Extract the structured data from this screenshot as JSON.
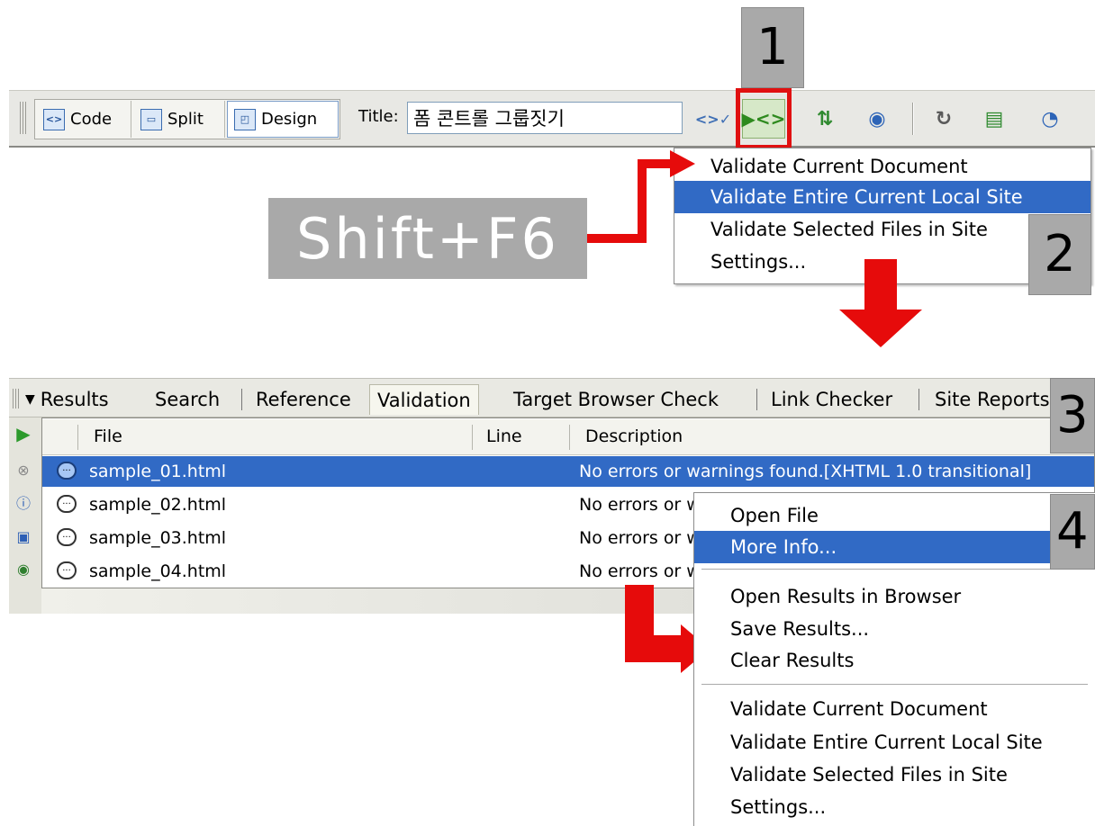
{
  "toolbar": {
    "views": [
      {
        "label": "Code",
        "icon": "code-view-icon"
      },
      {
        "label": "Split",
        "icon": "split-view-icon"
      },
      {
        "label": "Design",
        "icon": "design-view-icon"
      }
    ],
    "title_label": "Title:",
    "title_value": "폼 콘트롤 그룹짓기",
    "icons": [
      "browser-compat-icon",
      "validate-icon",
      "file-transfer-icon",
      "preview-browser-icon",
      "refresh-icon",
      "view-options-icon",
      "visual-aids-icon"
    ]
  },
  "callouts": {
    "one": "1",
    "two": "2",
    "three": "3",
    "four": "4"
  },
  "shortcut": "Shift+F6",
  "validate_menu": {
    "items": [
      {
        "label": "Validate Current Document",
        "selected": false
      },
      {
        "label": "Validate Entire Current Local Site",
        "selected": true
      },
      {
        "label": "Validate Selected Files in Site",
        "selected": false
      },
      {
        "label": "Settings...",
        "selected": false
      }
    ]
  },
  "results_panel": {
    "panel_title": "Results",
    "tabs": [
      "Search",
      "Reference",
      "Validation",
      "Target Browser Check",
      "Link Checker",
      "Site Reports"
    ],
    "active_tab": "Validation",
    "columns": [
      "File",
      "Line",
      "Description"
    ],
    "rows": [
      {
        "file": "sample_01.html",
        "line": "",
        "description": "No errors or warnings found.[XHTML 1.0 transitional]",
        "selected": true
      },
      {
        "file": "sample_02.html",
        "line": "",
        "description": "No errors or w",
        "selected": false
      },
      {
        "file": "sample_03.html",
        "line": "",
        "description": "No errors or w",
        "selected": false
      },
      {
        "file": "sample_04.html",
        "line": "",
        "description": "No errors or w",
        "selected": false
      }
    ],
    "side_icons": [
      "validate-run-icon",
      "stop-icon",
      "info-icon",
      "save-icon",
      "browse-icon"
    ]
  },
  "context_menu": {
    "group1": [
      {
        "label": "Open File",
        "selected": false
      },
      {
        "label": "More Info...",
        "selected": true
      }
    ],
    "group2": [
      "Open Results in Browser",
      "Save Results...",
      "Clear Results"
    ],
    "group3": [
      "Validate Current Document",
      "Validate Entire Current Local Site",
      "Validate Selected Files in Site",
      "Settings..."
    ]
  },
  "colors": {
    "selection": "#316ac5",
    "arrow": "#e60b0b",
    "callout": "#a9a9a9",
    "toolbar": "#e8e8e4"
  }
}
